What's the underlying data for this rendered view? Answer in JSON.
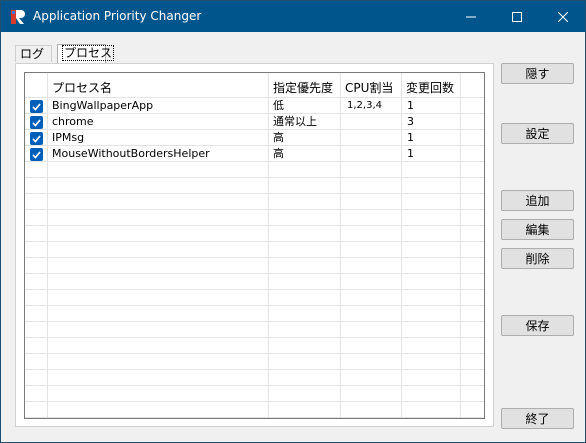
{
  "window": {
    "title": "Application Priority Changer"
  },
  "tabs": [
    {
      "label": "ログ"
    },
    {
      "label": "プロセス"
    }
  ],
  "table": {
    "columns": [
      "プロセス名",
      "指定優先度",
      "CPU割当",
      "変更回数"
    ],
    "rows": [
      {
        "checked": true,
        "name": "BingWallpaperApp",
        "priority": "低",
        "cpu": "1,2,3,4",
        "count": "1"
      },
      {
        "checked": true,
        "name": "chrome",
        "priority": "通常以上",
        "cpu": "",
        "count": "3"
      },
      {
        "checked": true,
        "name": "IPMsg",
        "priority": "高",
        "cpu": "",
        "count": "1"
      },
      {
        "checked": true,
        "name": "MouseWithoutBordersHelper",
        "priority": "高",
        "cpu": "",
        "count": "1"
      }
    ]
  },
  "buttons": {
    "hide": "隠す",
    "settings": "設定",
    "add": "追加",
    "edit": "編集",
    "delete": "削除",
    "save": "保存",
    "exit": "終了"
  },
  "colors": {
    "titlebar": "#00568c",
    "checkbox": "#005fb8"
  }
}
